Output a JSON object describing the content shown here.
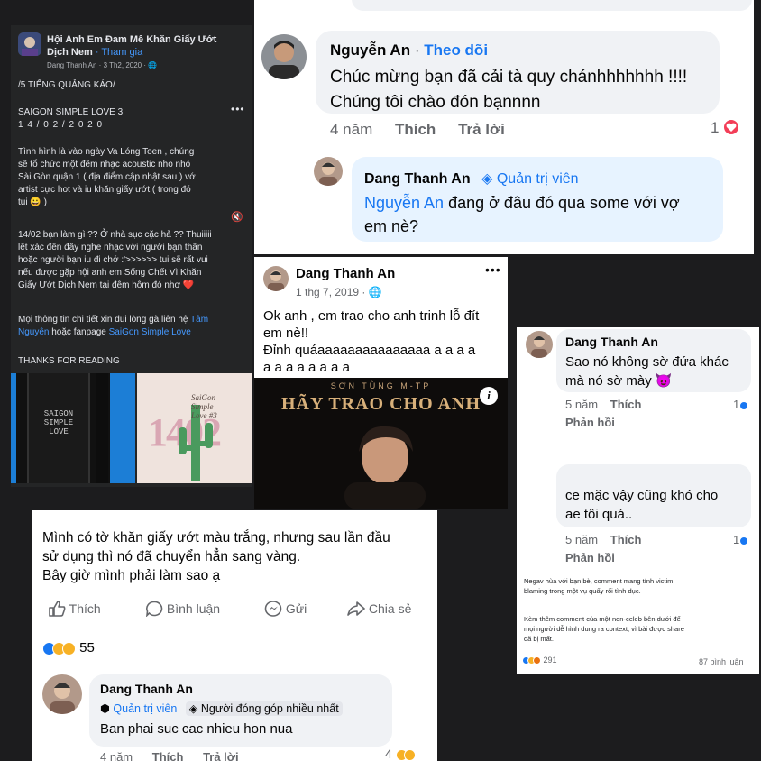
{
  "p1": {
    "group_name_line1": "Hội Anh Em Đam Mê Khăn Giấy Ướt",
    "group_name_line2": "Dịch Nem",
    "join_label": "· Tham gia",
    "author_meta": "Dang Thanh An · 3 Th2, 2020 · ",
    "tag_line": "/5 TIẾNG QUẢNG KÁO/",
    "event_title": "SAIGON SIMPLE LOVE 3",
    "event_date": "1 4 / 0 2 / 2 0 2 0",
    "body_lines": [
      "Tình hình là vào ngày Va Lóng Toen , chúng",
      "sẽ tổ chức một đêm nhạc acoustic nho nhỏ",
      "Sài Gòn quận 1 ( địa điểm cập nhật sau ) vớ",
      "artist cực hot và iu khăn giấy ướt ( trong đó",
      "tui 😀 )"
    ],
    "body2_lines": [
      "14/02 bạn làm gì ?? Ở nhà sục cặc hả ?? Thuiiiii",
      "lết xác đến đây nghe nhạc với người bạn thân",
      "hoặc người bạn iu đi chớ :'>>>>>> tui sẽ rất vui",
      "nếu được gặp hội anh em Sống Chết Vì Khăn",
      "Giấy Ướt Dịch Nem tại đêm hôm đó nhơ ❤️"
    ],
    "contact_a": "Mọi thông tin chi tiết xin dui lòng gà liên hệ ",
    "contact_link1": "Tâm",
    "contact_link1b": "Nguyên",
    "contact_b": " hoặc fanpage ",
    "contact_link2": "SaiGon Simple Love",
    "thanks": "THANKS FOR READING",
    "poster1_text": "SAIGON\nSIMPLE\nLOVE",
    "poster2_text": "SaiGon\nSimple\nLove #3",
    "poster2_big": "1402"
  },
  "p2": {
    "commenter": "Nguyễn An",
    "follow": "Theo dõi",
    "comment_line1": "Chúc mừng bạn đã cải tà quy chánhhhhhhh !!!!",
    "comment_line2": "Chúng tôi chào đón bạnnnn",
    "time": "4 năm",
    "like": "Thích",
    "reply": "Trả lời",
    "reaction_count": "1",
    "reply_author": "Dang Thanh An",
    "reply_role": "Quản trị viên",
    "reply_mention": "Nguyễn An",
    "reply_text_a": " đang ở đâu đó qua some với vợ",
    "reply_text_b": "em nè?"
  },
  "p3": {
    "author": "Dang Thanh An",
    "date": "1 thg 7, 2019 · ",
    "line1": "Ok anh , em trao cho anh trinh lỗ đít",
    "line2": "em nè!!",
    "line3": "Đỉnh quáaaaaaaaaaaaaaaa a a a a",
    "line4": "a a a a a a a a",
    "video_artist": "SƠN TÙNG M-TP",
    "video_title": "HÃY TRAO CHO ANH"
  },
  "p4": {
    "author": "Dang Thanh An",
    "comment1_line1": "Sao nó không sờ đứa khác",
    "comment1_line2": "mà nó sờ mày 😈",
    "time1": "5 năm",
    "like1": "Thích",
    "count1": "1",
    "reply1": "Phản hồi",
    "comment2_line1": "ce mặc vậy cũng khó cho",
    "comment2_line2": "ae tôi quá..",
    "time2": "5 năm",
    "like2": "Thích",
    "count2": "1",
    "reply2": "Phản hồi",
    "note_lines": [
      "Negav hùa với bạn bè, comment mang tính victim",
      "blaming trong một vụ quấy rối tình dục."
    ],
    "note2_lines": [
      "Kèm thêm comment của một non-celeb bên dưới để",
      "mọi người dễ hình dung ra context, vì bài được share",
      "đã bị mất."
    ],
    "reaction_total": "291",
    "comment_total": "87 bình luận"
  },
  "p5": {
    "post_line1": "Mình có tờ khăn giấy ướt màu trắng, nhưng sau lần đầu",
    "post_line2": "sử dụng thì nó đã chuyển hẳn sang vàng.",
    "post_line3": "Bây giờ mình phải làm sao ạ",
    "btn_like": "Thích",
    "btn_comment": "Bình luận",
    "btn_send": "Gửi",
    "btn_share": "Chia sẻ",
    "reaction_count": "55",
    "commenter": "Dang Thanh An",
    "badge1": "Quản trị viên",
    "badge2": "Người đóng góp nhiều nhất",
    "comment": "Ban phai suc cac nhieu hon nua",
    "time": "4 năm",
    "like": "Thích",
    "reply": "Trả lời",
    "comment_reactions": "4"
  },
  "colors": {
    "fb_blue": "#1877f2",
    "dark_bg": "#242526",
    "bubble_gray": "#f0f2f5",
    "reply_blue_bg": "#e7f3ff",
    "heart_red": "#f33e58",
    "haha_yellow": "#f7b125"
  }
}
